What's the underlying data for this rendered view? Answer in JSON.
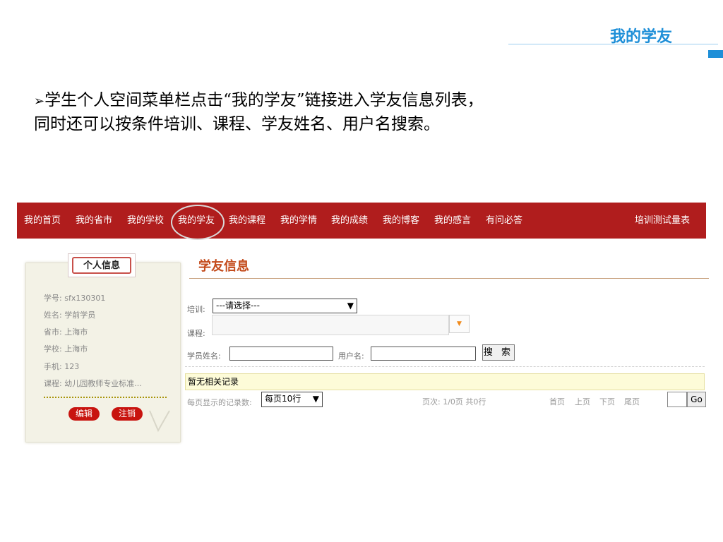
{
  "slide": {
    "title": "我的学友",
    "bullet": "➢",
    "description": "学生个人空间菜单栏点击“我的学友”链接进入学友信息列表，同时还可以按条件培训、课程、学友姓名、用户名搜索。"
  },
  "nav": {
    "items": [
      "我的首页",
      "我的省市",
      "我的学校",
      "我的学友",
      "我的课程",
      "我的学情",
      "我的成绩",
      "我的博客",
      "我的感言",
      "有问必答"
    ],
    "right": "培训测试量表"
  },
  "card": {
    "title": "个人信息",
    "rows": [
      {
        "label": "学号:",
        "value": "sfx130301"
      },
      {
        "label": "姓名:",
        "value": "学前学员"
      },
      {
        "label": "省市:",
        "value": "上海市"
      },
      {
        "label": "学校:",
        "value": "上海市"
      },
      {
        "label": "手机:",
        "value": "123"
      },
      {
        "label": "课程:",
        "value": "幼儿园教师专业标准..."
      }
    ],
    "edit_label": "编辑",
    "logout_label": "注销"
  },
  "main": {
    "section_title": "学友信息",
    "training_label": "培训:",
    "training_value": "---请选择---",
    "course_label": "课程:",
    "student_name_label": "学员姓名:",
    "username_label": "用户名:",
    "search_label": "搜 索",
    "no_record": "暂无相关记录",
    "per_page_label": "每页显示的记录数:",
    "per_page_value": "每页10行",
    "page_info": "页次: 1/0页 共0行",
    "first": "首页",
    "prev": "上页",
    "next": "下页",
    "last": "尾页",
    "go": "Go"
  },
  "colors": {
    "nav_bg": "#b01d1d",
    "title_blue": "#1e8fd8",
    "section_title": "#c34a1a"
  }
}
